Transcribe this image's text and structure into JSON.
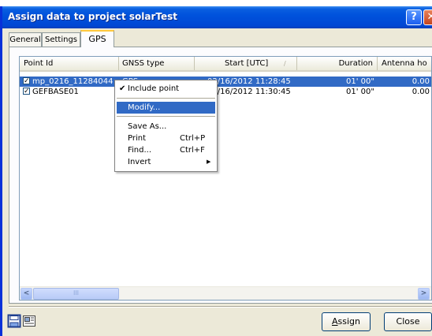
{
  "window": {
    "title": "Assign data to project solarTest",
    "help_glyph": "?",
    "close_glyph": "✕"
  },
  "tabs": [
    {
      "label": "General"
    },
    {
      "label": "Settings"
    },
    {
      "label": "GPS",
      "active": true
    }
  ],
  "table": {
    "columns": [
      "Point Id",
      "GNSS type",
      "Start [UTC]",
      "Duration",
      "Antenna ho"
    ],
    "sort_indicator": "∕",
    "rows": [
      {
        "checked": true,
        "point_id": "mp_0216_11284044",
        "gnss_type": "GPS",
        "start": "02/16/2012 11:28:45",
        "duration": "01' 00\"",
        "antenna": "0.00",
        "selected": true
      },
      {
        "checked": true,
        "point_id": "GEFBASE01",
        "gnss_type": "",
        "start": "02/16/2012 11:30:45",
        "duration": "01' 00\"",
        "antenna": "0.00",
        "selected": false
      }
    ],
    "scroll_thumb_grip": "III"
  },
  "context_menu": {
    "items": [
      {
        "label": "Include point",
        "checked": true,
        "check_glyph": "✔"
      },
      {
        "label": "Modify...",
        "highlighted": true
      },
      {
        "label": "Save As..."
      },
      {
        "label": "Print",
        "shortcut": "Ctrl+P"
      },
      {
        "label": "Find...",
        "shortcut": "Ctrl+F"
      },
      {
        "label": "Invert",
        "submenu_glyph": "▶"
      }
    ]
  },
  "footer": {
    "save_icon": "save-icon",
    "properties_icon": "properties-icon",
    "assign_label": "Assign",
    "close_label": "Close"
  },
  "colors": {
    "titlebar": "#0052dc",
    "selection": "#316ac5",
    "dialog_bg": "#ece9d8"
  }
}
